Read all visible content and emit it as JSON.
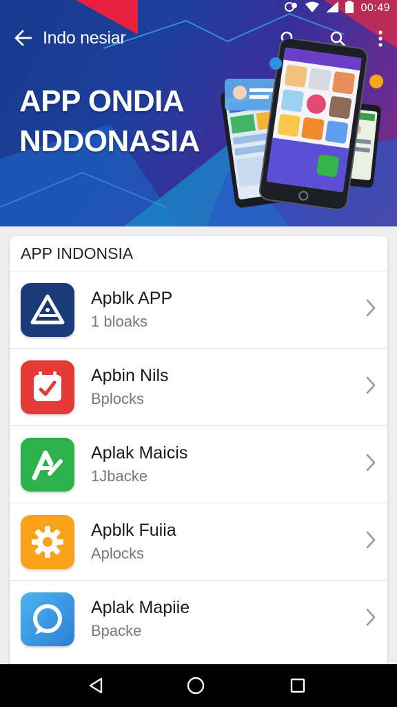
{
  "status_bar": {
    "time": "00:49"
  },
  "toolbar": {
    "title": "Indo nesiar"
  },
  "hero": {
    "title_line1": "APP ONDIA",
    "title_line2": "NDDONASIA"
  },
  "list": {
    "header": "APP INDONSIA",
    "items": [
      {
        "name": "Apblk APP",
        "subtitle": "1 bloaks",
        "icon": "triangle-logo-icon",
        "color": "#1a3a7a"
      },
      {
        "name": "Apbin Nils",
        "subtitle": "Bplocks",
        "icon": "calendar-check-icon",
        "color": "#e53935"
      },
      {
        "name": "Aplak Maicis",
        "subtitle": "1Jbacke",
        "icon": "letter-a-icon",
        "color": "#2bb24c"
      },
      {
        "name": "Apblk Fuiia",
        "subtitle": "Aplocks",
        "icon": "gear-icon",
        "color": "#f9a21a"
      },
      {
        "name": "Aplak Mapiie",
        "subtitle": "Bpacke",
        "icon": "chat-bubble-icon",
        "color": "#2d8fe0"
      }
    ]
  },
  "nav": {
    "back": "back-triangle-icon",
    "home": "home-circle-icon",
    "recents": "recents-square-icon"
  }
}
